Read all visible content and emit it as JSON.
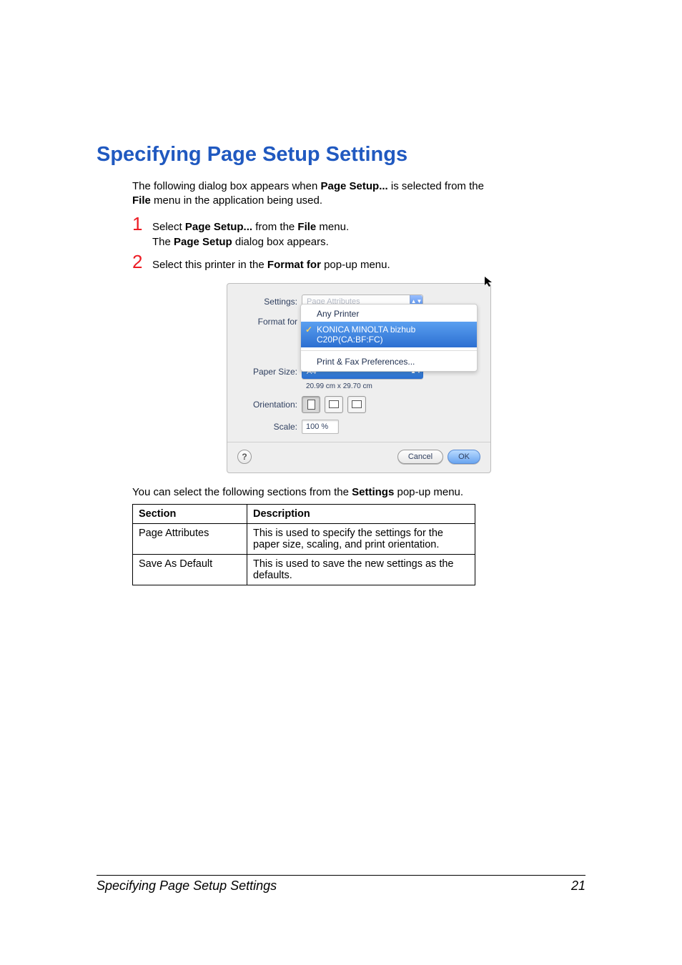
{
  "heading": "Specifying Page Setup Settings",
  "intro": {
    "line1_a": "The following dialog box appears when ",
    "line1_b": "Page Setup...",
    "line1_c": " is selected from the ",
    "line2_a": "File",
    "line2_b": " menu in the application being used."
  },
  "steps": {
    "s1": {
      "num": "1",
      "a": "Select ",
      "b": "Page Setup...",
      "c": " from the ",
      "d": "File",
      "e": " menu.",
      "sub_a": "The ",
      "sub_b": "Page Setup",
      "sub_c": " dialog box appears."
    },
    "s2": {
      "num": "2",
      "a": "Select this printer in the ",
      "b": "Format for",
      "c": " pop-up menu."
    }
  },
  "dialog": {
    "labels": {
      "settings": "Settings:",
      "format_for": "Format for",
      "paper_size": "Paper Size:",
      "orientation": "Orientation:",
      "scale": "Scale:"
    },
    "settings_value": "Page Attributes",
    "format_menu": {
      "any": "Any Printer",
      "selected": "KONICA MINOLTA bizhub C20P(CA:BF:FC)",
      "prefs": "Print & Fax Preferences..."
    },
    "paper_size_value": "A4",
    "paper_dims": "20.99 cm x 29.70 cm",
    "scale_value": "100 %",
    "buttons": {
      "cancel": "Cancel",
      "ok": "OK",
      "help": "?"
    }
  },
  "pre_table": {
    "a": "You can select the following sections from the ",
    "b": "Settings",
    "c": " pop-up menu."
  },
  "table": {
    "header": {
      "section": "Section",
      "description": "Description"
    },
    "rows": [
      {
        "section": "Page Attributes",
        "desc": "This is used to specify the settings for the paper size, scaling, and print orientation."
      },
      {
        "section": "Save As Default",
        "desc": "This is used to save the new settings as the defaults."
      }
    ]
  },
  "footer": {
    "left": "Specifying Page Setup Settings",
    "right": "21"
  }
}
